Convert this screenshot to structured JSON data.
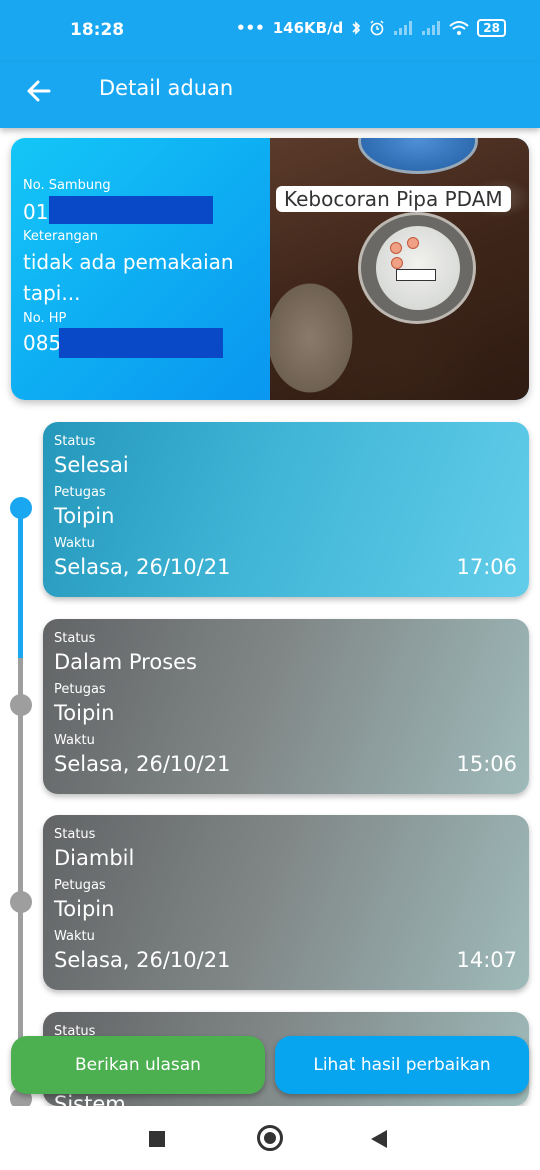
{
  "statusbar": {
    "time": "18:28",
    "net_speed": "146KB/d",
    "battery": "28",
    "icons": [
      "dots-icon",
      "bluetooth-icon",
      "alarm-icon",
      "signal-icon",
      "signal-icon",
      "wifi-icon",
      "battery-icon"
    ]
  },
  "appbar": {
    "title": "Detail aduan",
    "back_icon": "arrow-left-icon"
  },
  "complaint": {
    "no_sambung_label": "No. Sambung",
    "no_sambung_value": "01",
    "keterangan_label": "Keterangan",
    "keterangan_value_line1": "tidak ada pemakaian",
    "keterangan_value_line2": "tapi...",
    "no_hp_label": "No. HP",
    "no_hp_value": "085",
    "category": "Kebocoran Pipa PDAM",
    "redaction_color": "#0948c6"
  },
  "timeline": {
    "active_color": "#1aa7f2",
    "inactive_color": "#9e9e9e",
    "items": [
      {
        "status_label": "Status",
        "status": "Selesai",
        "petugas_label": "Petugas",
        "petugas": "Toipin",
        "waktu_label": "Waktu",
        "date": "Selasa, 26/10/21",
        "time": "17:06",
        "active": true
      },
      {
        "status_label": "Status",
        "status": "Dalam Proses",
        "petugas_label": "Petugas",
        "petugas": "Toipin",
        "waktu_label": "Waktu",
        "date": "Selasa, 26/10/21",
        "time": "15:06",
        "active": false
      },
      {
        "status_label": "Status",
        "status": "Diambil",
        "petugas_label": "Petugas",
        "petugas": "Toipin",
        "waktu_label": "Waktu",
        "date": "Selasa, 26/10/21",
        "time": "14:07",
        "active": false
      },
      {
        "status_label": "Status",
        "status": "Sistem",
        "active": false
      }
    ]
  },
  "actions": {
    "review_button": "Berikan ulasan",
    "repair_button": "Lihat hasil perbaikan",
    "review_color": "#4caf50",
    "repair_color": "#07a4f0"
  },
  "navbar": {
    "recents_icon": "square-icon",
    "home_icon": "circle-home-icon",
    "back_icon": "triangle-back-icon"
  }
}
